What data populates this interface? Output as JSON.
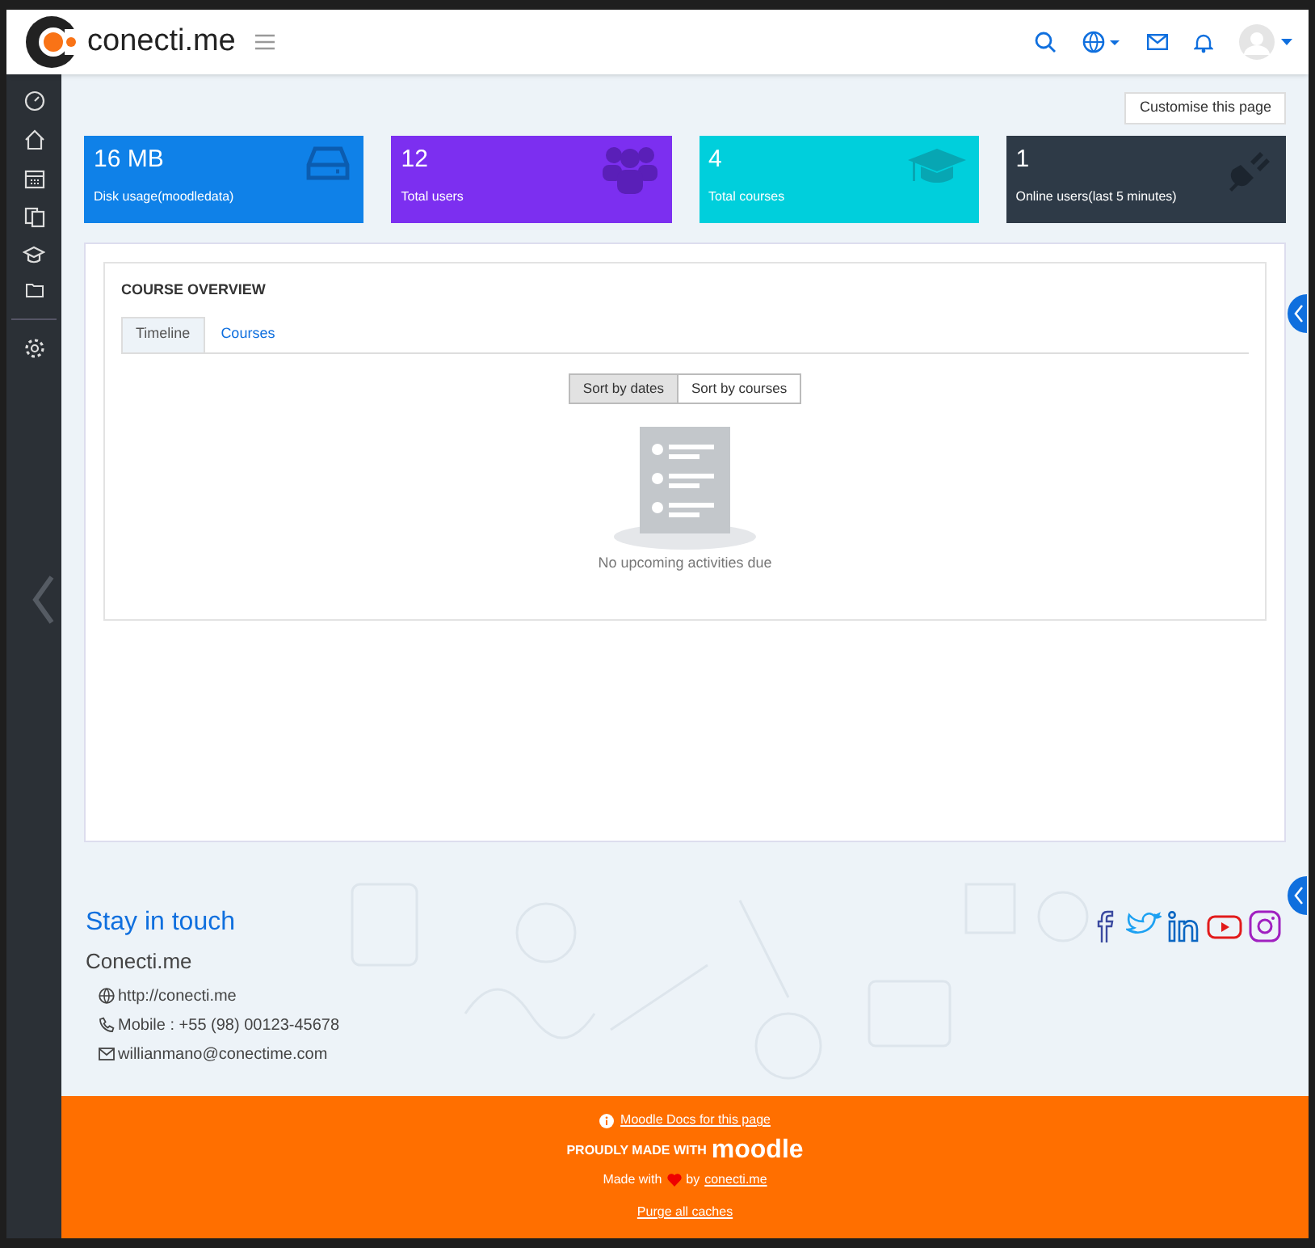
{
  "header": {
    "logo_text": "conecti.me"
  },
  "customise_button": "Customise this page",
  "stats": [
    {
      "value": "16 MB",
      "label": "Disk usage(moodledata)",
      "color": "#0f81e8",
      "kind": "disk"
    },
    {
      "value": "12",
      "label": "Total users",
      "color": "#7c2ff0",
      "kind": "users"
    },
    {
      "value": "4",
      "label": "Total courses",
      "color": "#00cfdc",
      "kind": "courses"
    },
    {
      "value": "1",
      "label": "Online users(last 5 minutes)",
      "color": "#2e3a47",
      "kind": "plug"
    }
  ],
  "course_overview": {
    "title": "COURSE OVERVIEW",
    "tabs": [
      {
        "label": "Timeline",
        "selected": true
      },
      {
        "label": "Courses",
        "selected": false
      }
    ],
    "sort_buttons": [
      {
        "label": "Sort by dates",
        "selected": true
      },
      {
        "label": "Sort by courses",
        "selected": false
      }
    ],
    "empty_message": "No upcoming activities due"
  },
  "footer": {
    "heading": "Stay in touch",
    "company": "Conecti.me",
    "contacts": [
      {
        "kind": "web",
        "text": "http://conecti.me"
      },
      {
        "kind": "phone",
        "text": "Mobile : +55 (98) 00123-45678"
      },
      {
        "kind": "email",
        "text": "willianmano@conectime.com"
      }
    ],
    "docs_link": "Moodle Docs for this page",
    "made_by_prefix": "PROUDLY MADE WITH",
    "brand": "moodle",
    "made_with": "Made with",
    "by": "by",
    "credit_link": "conecti.me",
    "purge_link": "Purge all caches"
  }
}
